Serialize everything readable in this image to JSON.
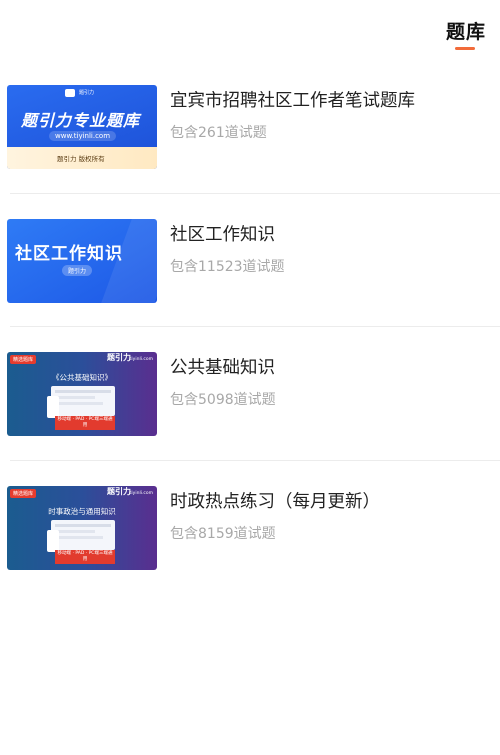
{
  "header": {
    "tab_label": "题库"
  },
  "colors": {
    "accent": "#f26b3a",
    "title": "#222222",
    "count": "#a8a8a8"
  },
  "items": [
    {
      "title": "宜宾市招聘社区工作者笔试题库",
      "count": "包含261道试题",
      "thumb": {
        "headline": "题引力专业题库",
        "url": "www.tiyinli.com",
        "sub": "题引力 版权所有",
        "logo_text": "题引力"
      }
    },
    {
      "title": "社区工作知识",
      "count": "包含11523道试题",
      "thumb": {
        "headline": "社区工作知识",
        "sub": "题引力"
      }
    },
    {
      "title": "公共基础知识",
      "count": "包含5098道试题",
      "thumb": {
        "badge": "精选题库",
        "brand": "题引力",
        "url": "tiyinli.com",
        "headline": "《公共基础知识》",
        "caption": "移动端 · PAD · PC端三端通用"
      }
    },
    {
      "title": "时政热点练习（每月更新）",
      "count": "包含8159道试题",
      "thumb": {
        "badge": "精选题库",
        "brand": "题引力",
        "url": "tiyinli.com",
        "headline": "时事政治与通用知识",
        "caption": "移动端 · PAD · PC端三端通用"
      }
    }
  ]
}
